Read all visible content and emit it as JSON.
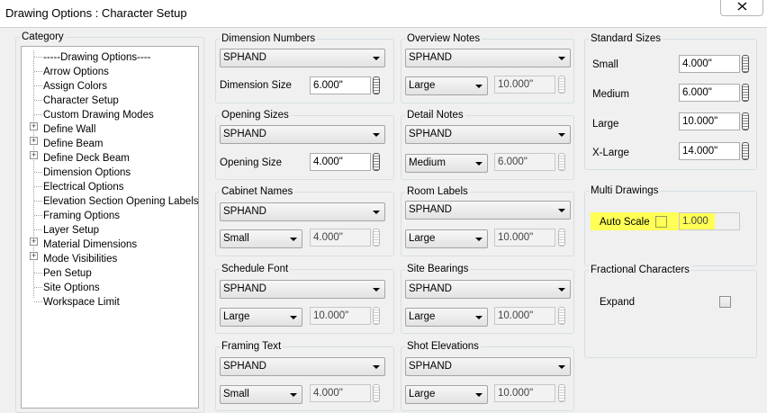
{
  "window": {
    "title": "Drawing Options : Character Setup"
  },
  "category": {
    "label": "Category",
    "items": [
      {
        "label": "-----Drawing Options----",
        "expandable": false
      },
      {
        "label": "Arrow Options",
        "expandable": false
      },
      {
        "label": "Assign Colors",
        "expandable": false
      },
      {
        "label": "Character Setup",
        "expandable": false
      },
      {
        "label": "Custom Drawing Modes",
        "expandable": false
      },
      {
        "label": "Define Wall",
        "expandable": true
      },
      {
        "label": "Define Beam",
        "expandable": true
      },
      {
        "label": "Define Deck Beam",
        "expandable": true
      },
      {
        "label": "Dimension Options",
        "expandable": false
      },
      {
        "label": "Electrical Options",
        "expandable": false
      },
      {
        "label": "Elevation Section Opening Labels",
        "expandable": false
      },
      {
        "label": "Framing Options",
        "expandable": false
      },
      {
        "label": "Layer Setup",
        "expandable": false
      },
      {
        "label": "Material Dimensions",
        "expandable": true
      },
      {
        "label": "Mode Visibilities",
        "expandable": true
      },
      {
        "label": "Pen Setup",
        "expandable": false
      },
      {
        "label": "Site Options",
        "expandable": false
      },
      {
        "label": "Workspace Limit",
        "expandable": false
      }
    ]
  },
  "groups": {
    "dimension_numbers": {
      "label": "Dimension Numbers",
      "font": "SPHAND",
      "size_label": "Dimension Size",
      "size": "6.000\""
    },
    "opening_sizes": {
      "label": "Opening Sizes",
      "font": "SPHAND",
      "size_label": "Opening Size",
      "size": "4.000\""
    },
    "cabinet_names": {
      "label": "Cabinet Names",
      "font": "SPHAND",
      "size_choice": "Small",
      "size": "4.000\""
    },
    "schedule_font": {
      "label": "Schedule Font",
      "font": "SPHAND",
      "size_choice": "Large",
      "size": "10.000\""
    },
    "framing_text": {
      "label": "Framing Text",
      "font": "SPHAND",
      "size_choice": "Small",
      "size": "4.000\""
    },
    "overview_notes": {
      "label": "Overview Notes",
      "font": "SPHAND",
      "size_choice": "Large",
      "size": "10.000\""
    },
    "detail_notes": {
      "label": "Detail Notes",
      "font": "SPHAND",
      "size_choice": "Medium",
      "size": "6.000\""
    },
    "room_labels": {
      "label": "Room Labels",
      "font": "SPHAND",
      "size_choice": "Large",
      "size": "10.000\""
    },
    "site_bearings": {
      "label": "Site Bearings",
      "font": "SPHAND",
      "size_choice": "Large",
      "size": "10.000\""
    },
    "shot_elevations": {
      "label": "Shot Elevations",
      "font": "SPHAND",
      "size_choice": "Large",
      "size": "10.000\""
    }
  },
  "standard_sizes": {
    "label": "Standard Sizes",
    "small_label": "Small",
    "small": "4.000\"",
    "medium_label": "Medium",
    "medium": "6.000\"",
    "large_label": "Large",
    "large": "10.000\"",
    "xlarge_label": "X-Large",
    "xlarge": "14.000\""
  },
  "multi_drawings": {
    "label": "Multi Drawings",
    "auto_scale_label": "Auto Scale",
    "auto_scale_checked": false,
    "scale": "1.000",
    "highlight_color": "#ffff55"
  },
  "fractional": {
    "label": "Fractional Characters",
    "expand_label": "Expand",
    "expand_checked": false
  }
}
